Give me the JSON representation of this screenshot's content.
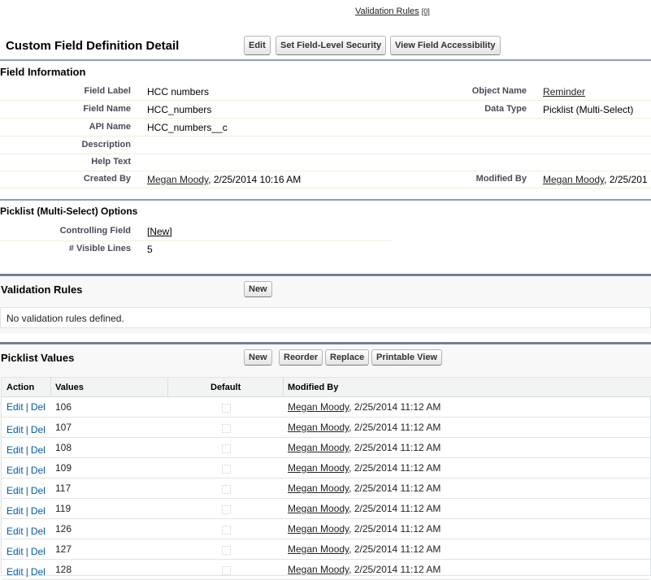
{
  "top_link": {
    "label": "Validation Rules",
    "count": "[0]"
  },
  "title": "Custom Field Definition Detail",
  "title_buttons": [
    "Edit",
    "Set Field-Level Security",
    "View Field Accessibility"
  ],
  "field_info": {
    "heading": "Field Information",
    "left": [
      {
        "label": "Field Label",
        "value": "HCC numbers"
      },
      {
        "label": "Field Name",
        "value": "HCC_numbers"
      },
      {
        "label": "API Name",
        "value": "HCC_numbers__c"
      },
      {
        "label": "Description",
        "value": ""
      },
      {
        "label": "Help Text",
        "value": ""
      },
      {
        "label": "Created By",
        "link": "Megan Moody",
        "value": ", 2/25/2014 10:16 AM"
      }
    ],
    "right": [
      {
        "label": "Object Name",
        "link": "Reminder"
      },
      {
        "label": "Data Type",
        "value": "Picklist (Multi-Select)"
      },
      {
        "label": "Modified By",
        "link": "Megan Moody",
        "value": ", 2/25/201"
      }
    ]
  },
  "picklist_options": {
    "heading": "Picklist (Multi-Select) Options",
    "rows": [
      {
        "label": "Controlling Field",
        "link": "[New]"
      },
      {
        "label": "# Visible Lines",
        "value": "5"
      }
    ]
  },
  "validation_rules": {
    "heading": "Validation Rules",
    "new_label": "New",
    "empty": "No validation rules defined."
  },
  "picklist_values": {
    "heading": "Picklist Values",
    "buttons": [
      "New",
      "Reorder",
      "Replace",
      "Printable View"
    ],
    "columns": [
      "Action",
      "Values",
      "Default",
      "Modified By"
    ],
    "edit": "Edit",
    "sep": "|",
    "del": "Del",
    "rows": [
      {
        "value": "106",
        "user": "Megan Moody",
        "date": ", 2/25/2014 11:12 AM"
      },
      {
        "value": "107",
        "user": "Megan Moody",
        "date": ", 2/25/2014 11:12 AM"
      },
      {
        "value": "108",
        "user": "Megan Moody",
        "date": ", 2/25/2014 11:12 AM"
      },
      {
        "value": "109",
        "user": "Megan Moody",
        "date": ", 2/25/2014 11:12 AM"
      },
      {
        "value": "117",
        "user": "Megan Moody",
        "date": ", 2/25/2014 11:12 AM"
      },
      {
        "value": "119",
        "user": "Megan Moody",
        "date": ", 2/25/2014 11:12 AM"
      },
      {
        "value": "126",
        "user": "Megan Moody",
        "date": ", 2/25/2014 11:12 AM"
      },
      {
        "value": "127",
        "user": "Megan Moody",
        "date": ", 2/25/2014 11:12 AM"
      },
      {
        "value": "128",
        "user": "Megan Moody",
        "date": ", 2/25/2014 11:12 AM"
      }
    ]
  }
}
